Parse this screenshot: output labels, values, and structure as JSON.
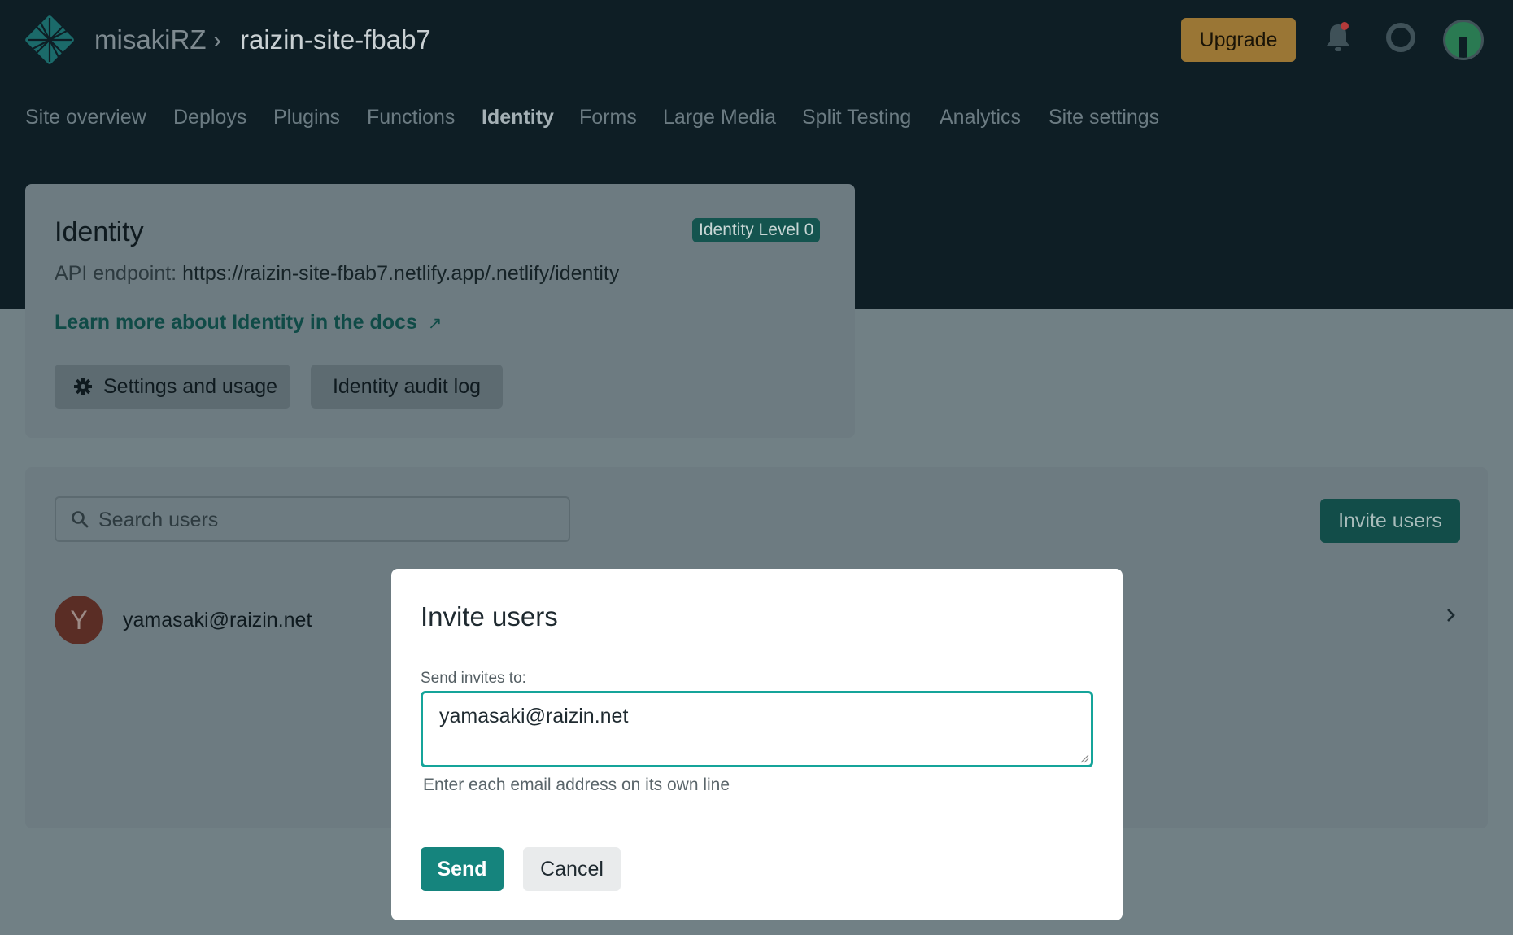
{
  "header": {
    "team": "misakiRZ",
    "separator": "›",
    "site": "raizin-site-fbab7",
    "upgrade_label": "Upgrade",
    "icons": [
      "netlify-logo-icon",
      "bell-icon",
      "help-lifebuoy-icon",
      "user-avatar"
    ]
  },
  "nav": {
    "items": [
      {
        "label": "Site overview"
      },
      {
        "label": "Deploys"
      },
      {
        "label": "Plugins"
      },
      {
        "label": "Functions"
      },
      {
        "label": "Identity"
      },
      {
        "label": "Forms"
      },
      {
        "label": "Large Media"
      },
      {
        "label": "Split Testing"
      },
      {
        "label": "Analytics"
      },
      {
        "label": "Site settings"
      }
    ],
    "active": "Identity"
  },
  "identity": {
    "title": "Identity",
    "badge": "Identity Level 0",
    "api_label": "API endpoint:",
    "api_url": "https://raizin-site-fbab7.netlify.app/.netlify/identity",
    "learn_more": "Learn more about Identity in the docs",
    "learn_more_arrow": "↗",
    "settings_label": "Settings and usage",
    "audit_label": "Identity audit log"
  },
  "users": {
    "search_placeholder": "Search users",
    "invite_label": "Invite users",
    "list": [
      {
        "initial": "Y",
        "email": "yamasaki@raizin.net"
      }
    ]
  },
  "modal": {
    "title": "Invite users",
    "field_label": "Send invites to:",
    "field_value": "yamasaki@raizin.net",
    "hint": "Enter each email address on its own line",
    "send_label": "Send",
    "cancel_label": "Cancel"
  },
  "colors": {
    "header_bg": "#0e1e25",
    "overlay_bg": "#718085",
    "accent_teal": "#15847d",
    "upgrade": "#9a7635"
  }
}
